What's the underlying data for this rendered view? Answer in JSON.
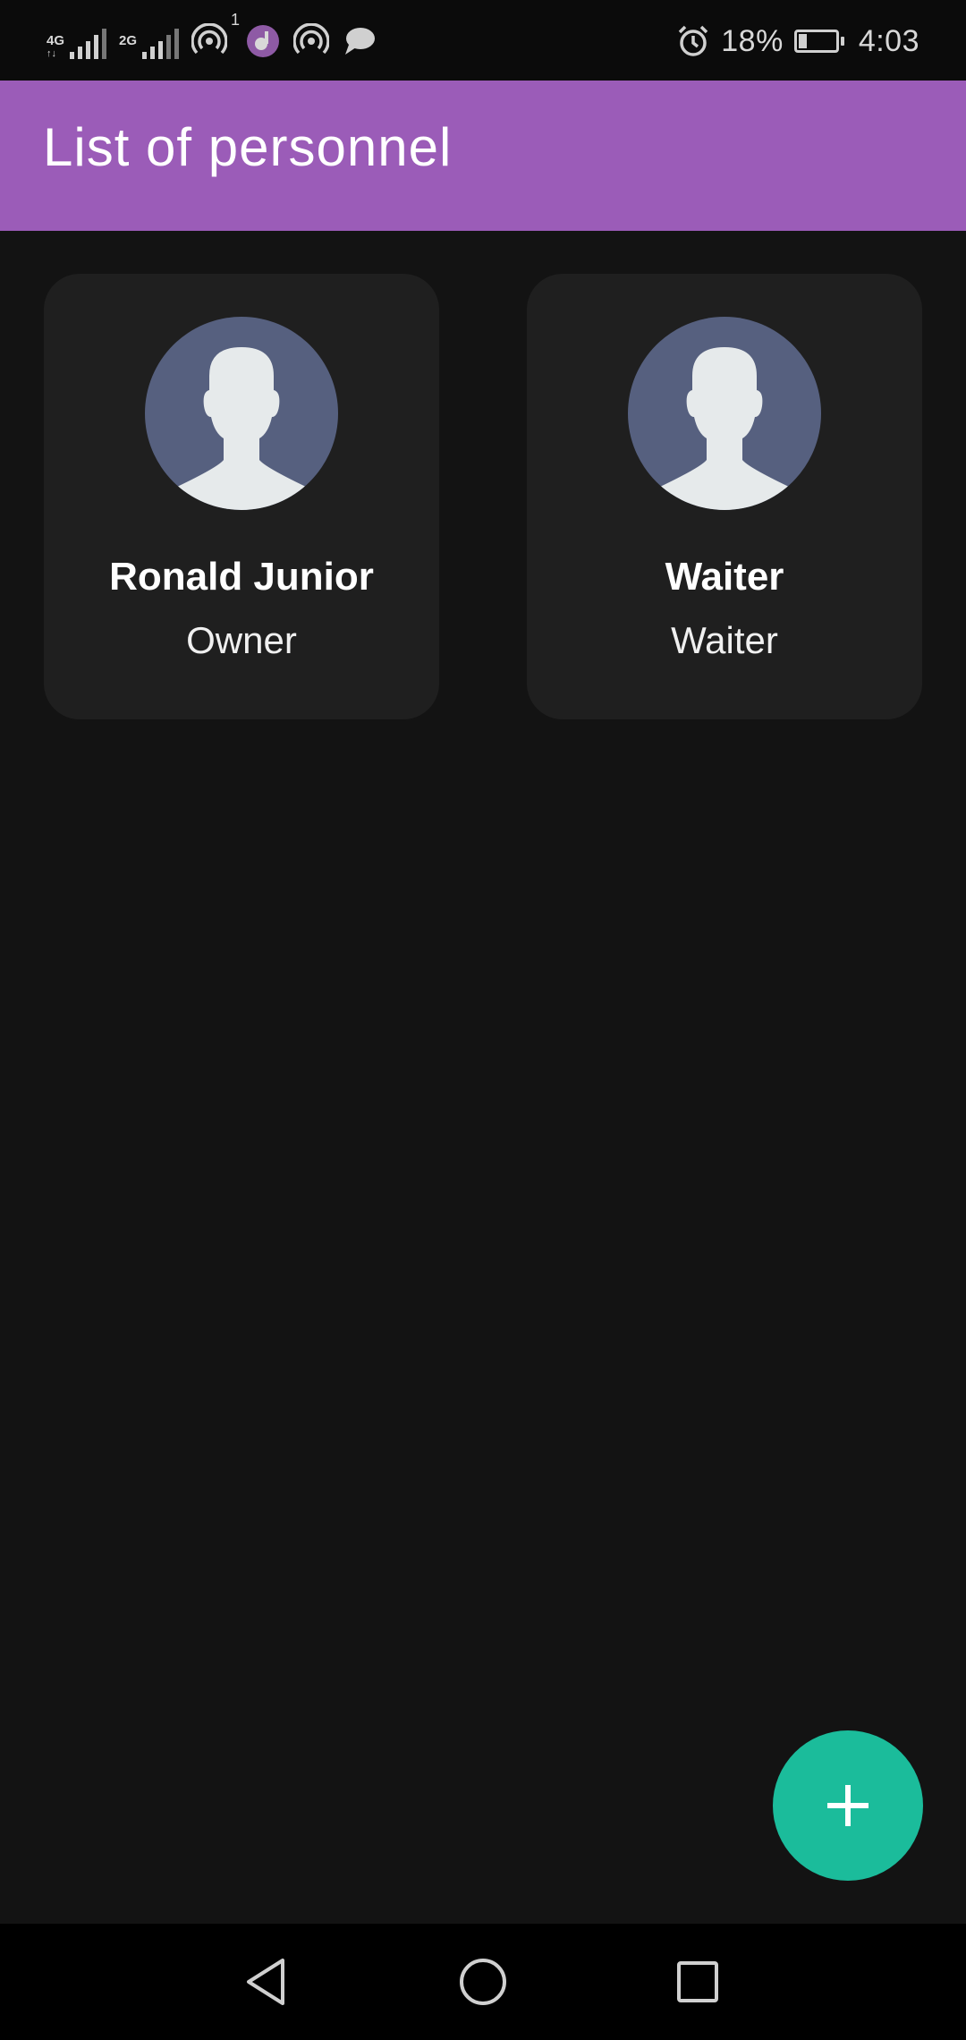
{
  "status_bar": {
    "sim1_type": "4G",
    "sim2_type": "2G",
    "notification_count": "1",
    "battery_percent": "18%",
    "time": "4:03",
    "icons": [
      "signal-icon",
      "signal-icon",
      "hotspot-icon",
      "music-app-icon",
      "hotspot-icon",
      "message-icon",
      "alarm-icon",
      "battery-charging-icon"
    ]
  },
  "app_bar": {
    "title": "List of personnel"
  },
  "personnel": [
    {
      "name": "Ronald Junior",
      "role": "Owner",
      "avatar": "avatar-placeholder-icon"
    },
    {
      "name": "Waiter",
      "role": "Waiter",
      "avatar": "avatar-placeholder-icon"
    }
  ],
  "fab": {
    "icon": "plus-icon"
  },
  "nav_bar": {
    "icons": [
      "back-icon",
      "home-icon",
      "recents-icon"
    ]
  },
  "colors": {
    "app_bar": "#9b5cb8",
    "background": "#131313",
    "card": "#1f1f1f",
    "fab": "#1bbc9b",
    "avatar_bg": "#56607f",
    "avatar_fg": "#e6eaeb"
  }
}
